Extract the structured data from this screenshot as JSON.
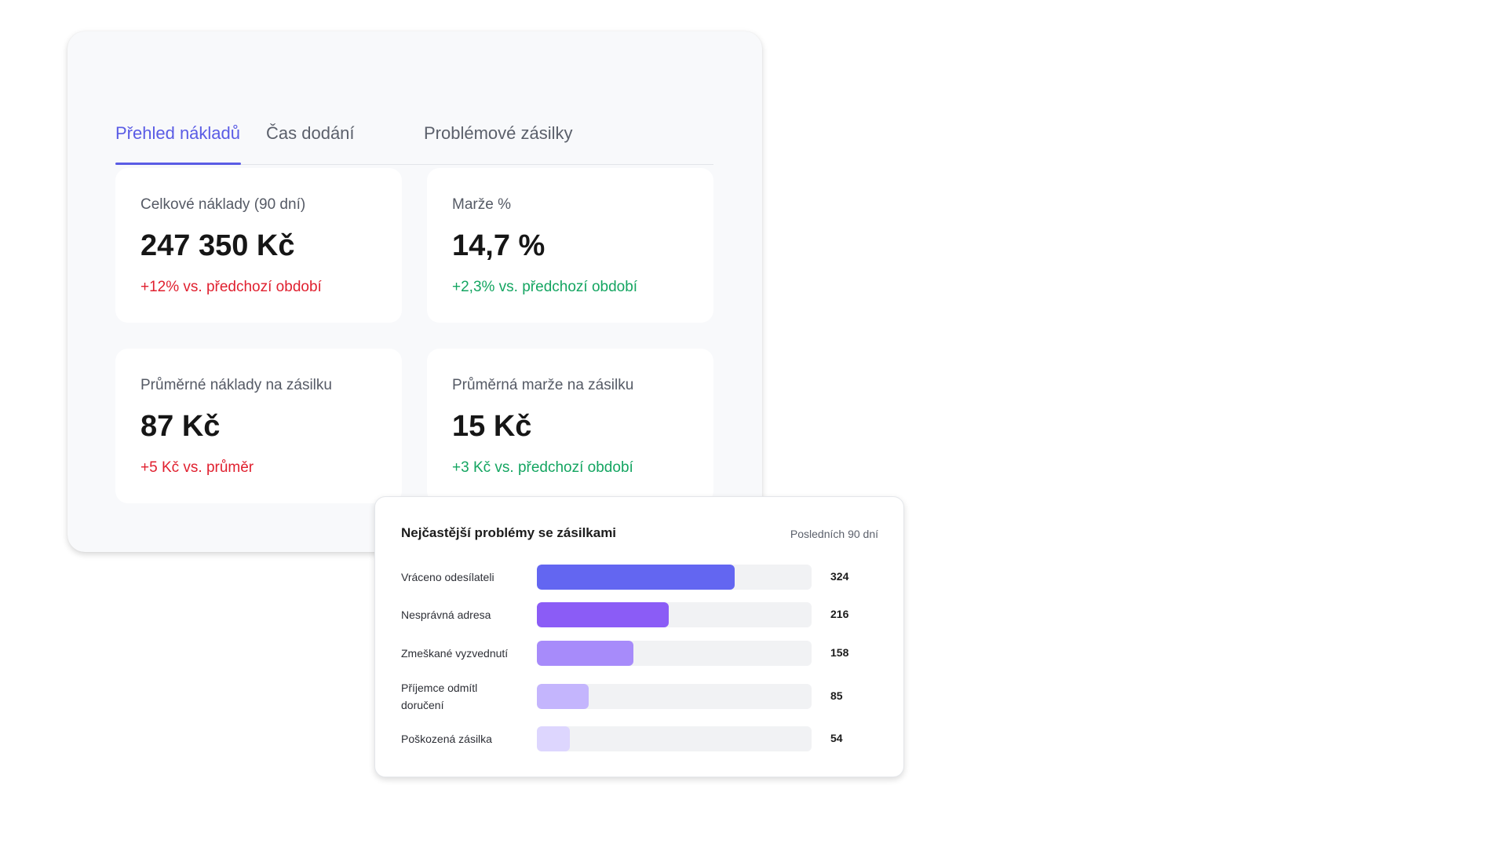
{
  "tabs": [
    {
      "label": "Přehled nákladů",
      "active": true
    },
    {
      "label": "Čas dodání",
      "active": false
    },
    {
      "label": "Problémové zásilky",
      "active": false
    }
  ],
  "metrics": [
    {
      "label": "Celkové náklady (90 dní)",
      "value": "247 350 Kč",
      "delta": "+12% vs. předchozí období",
      "delta_color": "#e0202f"
    },
    {
      "label": "Marže %",
      "value": "14,7 %",
      "delta": "+2,3% vs. předchozí období",
      "delta_color": "#14a561"
    },
    {
      "label": "Průměrné náklady na zásilku",
      "value": "87 Kč",
      "delta": "+5 Kč vs. průměr",
      "delta_color": "#e0202f"
    },
    {
      "label": "Průměrná marže na zásilku",
      "value": "15 Kč",
      "delta": "+3 Kč vs. předchozí období",
      "delta_color": "#14a561"
    }
  ],
  "issues_panel": {
    "title": "Nejčastější problémy se zásilkami",
    "period": "Posledních 90 dní"
  },
  "chart_data": {
    "type": "bar",
    "orientation": "horizontal",
    "categories": [
      "Vráceno odesílateli",
      "Nesprávná adresa",
      "Zmeškané vyzvednutí",
      "Příjemce odmítl doručení",
      "Poškozená zásilka"
    ],
    "values": [
      324,
      216,
      158,
      85,
      54
    ],
    "colors": [
      "#6366f1",
      "#8b5cf6",
      "#a78bfa",
      "#c4b5fd",
      "#ddd6fe"
    ],
    "xlim": [
      0,
      450
    ],
    "grid": false
  },
  "colors": {
    "accent": "#5a5ce5",
    "negative": "#e0202f",
    "positive": "#14a561"
  }
}
